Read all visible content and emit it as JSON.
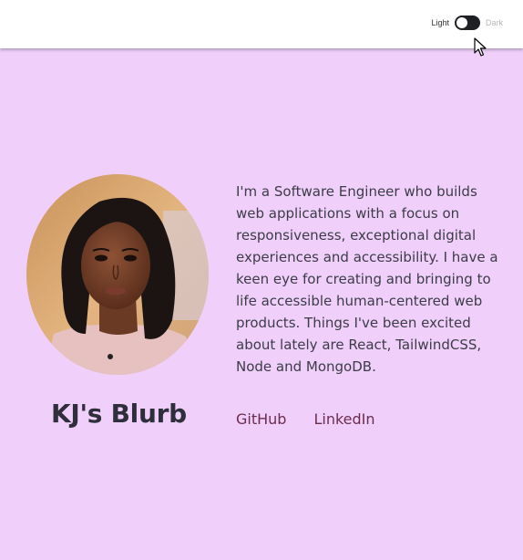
{
  "header": {
    "theme_toggle": {
      "light_label": "Light",
      "dark_label": "Dark"
    }
  },
  "profile": {
    "avatar_alt": "profile portrait",
    "bio": "I'm a Software Engineer who builds web applications with a focus on responsiveness, exceptional digital experiences and accessibility. I have a keen eye for creating and bringing to life accessible human-centered web products. Things I've been excited about lately are React, TailwindCSS, Node and MongoDB.",
    "title": "KJ's Blurb"
  },
  "links": {
    "github": "GitHub",
    "linkedin": "LinkedIn"
  },
  "colors": {
    "background": "#f0d0fb",
    "header": "#ffffff",
    "toggle_track": "#1f2023",
    "link": "#6b2d4d",
    "text": "#3c3c46"
  }
}
